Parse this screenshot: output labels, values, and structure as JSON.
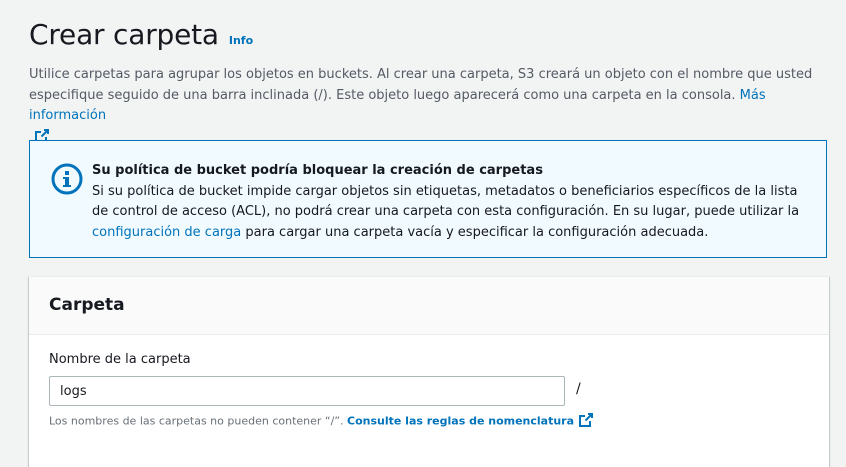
{
  "header": {
    "title": "Crear carpeta",
    "info_label": "Info"
  },
  "description": {
    "text": "Utilice carpetas para agrupar los objetos en buckets. Al crear una carpeta, S3 creará un objeto con el nombre que usted especifique seguido de una barra inclinada (/). Este objeto luego aparecerá como una carpeta en la consola.",
    "link_label": "Más información",
    "link_icon": "external-link-icon"
  },
  "alert": {
    "type": "info",
    "icon": "info-circle-icon",
    "title": "Su política de bucket podría bloquear la creación de carpetas",
    "text_before_link": "Si su política de bucket impide cargar objetos sin etiquetas, metadatos o beneficiarios específicos de la lista de control de acceso (ACL), no podrá crear una carpeta con esta configuración. En su lugar, puede utilizar la",
    "link_label": "configuración de carga",
    "text_after_link": "para cargar una carpeta vacía y especificar la configuración adecuada."
  },
  "folder_panel": {
    "title": "Carpeta",
    "field_label": "Nombre de la carpeta",
    "field_value": "logs",
    "suffix": "/",
    "constraint_text": "Los nombres de las carpetas no pueden contener “/”.",
    "constraint_link_label": "Consulte las reglas de nomenclatura",
    "constraint_link_icon": "external-link-icon"
  },
  "colors": {
    "link": "#0073bb",
    "background": "#f2f3f3",
    "alert_background": "#f1faff",
    "alert_border": "#0073bb"
  }
}
